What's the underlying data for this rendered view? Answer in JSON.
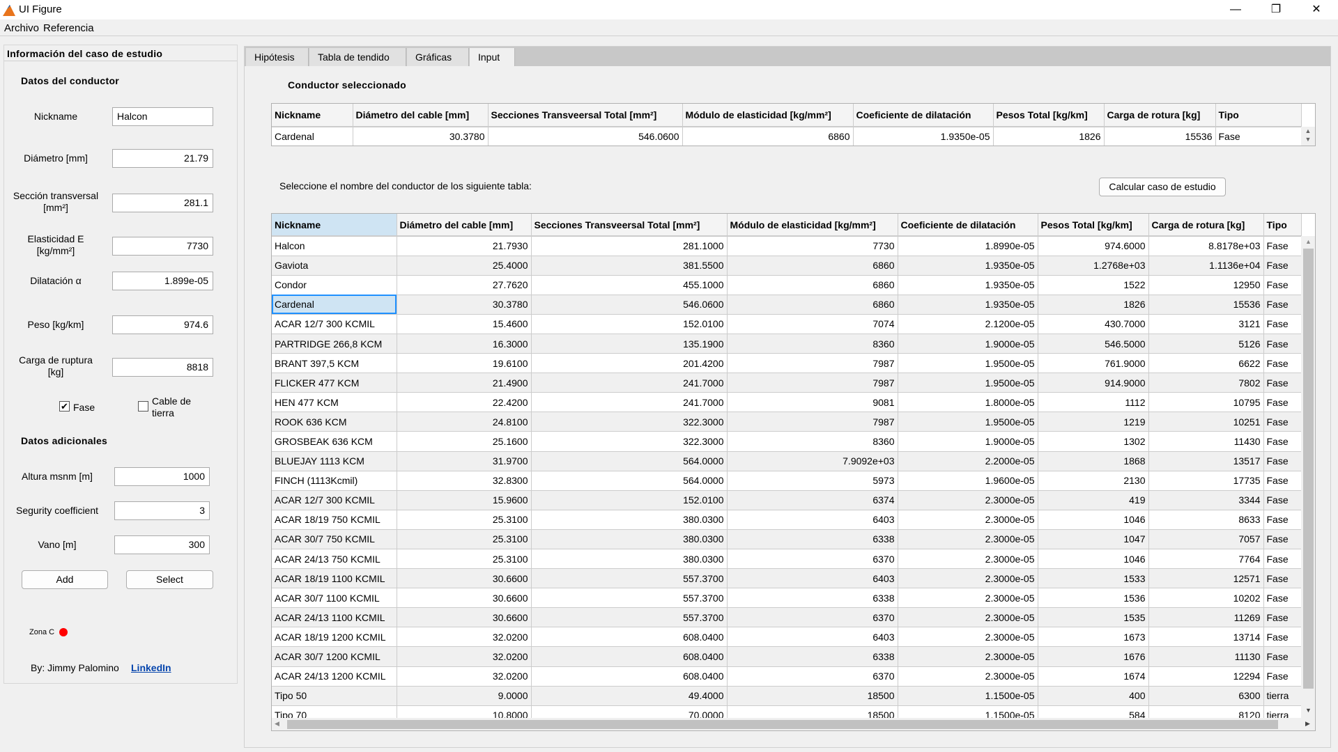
{
  "window": {
    "title": "UI Figure",
    "minimize": "—",
    "restore": "❐",
    "close": "✕"
  },
  "menu": [
    "Archivo",
    "Referencia"
  ],
  "left": {
    "title": "Información del caso de estudio",
    "conductor_heading": "Datos del conductor",
    "fields": [
      {
        "label": "Nickname",
        "value": "Halcon"
      },
      {
        "label": "Diámetro [mm]",
        "value": "21.79"
      },
      {
        "label": "Sección transversal [mm²]",
        "value": "281.1"
      },
      {
        "label": "Elasticidad E [kg/mm²]",
        "value": "7730"
      },
      {
        "label": "Dilatación α",
        "value": "1.899e-05"
      },
      {
        "label": "Peso [kg/km]",
        "value": "974.6"
      },
      {
        "label": "Carga de ruptura [kg]",
        "value": "8818"
      }
    ],
    "fase": {
      "label": "Fase",
      "checked": true
    },
    "tierra": {
      "label": "Cable de tierra",
      "checked": false
    },
    "additional_heading": "Datos adicionales",
    "extra": [
      {
        "label": "Altura msnm [m]",
        "value": "1000"
      },
      {
        "label": "Segurity coefficient",
        "value": "3"
      },
      {
        "label": "Vano [m]",
        "value": "300"
      }
    ],
    "add": "Add",
    "select": "Select",
    "zona": "Zona C",
    "zona_color": "#ff0000",
    "by": "By: Jimmy Palomino",
    "link": "LinkedIn"
  },
  "tabs": [
    {
      "label": "Hipótesis"
    },
    {
      "label": "Tabla de tendido"
    },
    {
      "label": "Gráficas"
    },
    {
      "label": "Input",
      "active": true
    }
  ],
  "selected": {
    "title": "Conductor seleccionado",
    "columns": [
      "Nickname",
      "Diámetro del cable [mm]",
      "Secciones Transveersal Total [mm²]",
      "Módulo de elasticidad [kg/mm²]",
      "Coeficiente de dilatación",
      "Pesos Total [kg/km]",
      "Carga de rotura [kg]",
      "Tipo"
    ],
    "row": [
      "Cardenal",
      "30.3780",
      "546.0600",
      "6860",
      "1.9350e-05",
      "1826",
      "15536",
      "Fase"
    ]
  },
  "instruction": "Seleccione el nombre del conductor de los siguiente tabla:",
  "calc_button": "Calcular caso de estudio",
  "table": {
    "columns": [
      "Nickname",
      "Diámetro del cable [mm]",
      "Secciones Transveersal Total [mm²]",
      "Módulo de elasticidad [kg/mm²]",
      "Coeficiente de dilatación",
      "Pesos Total [kg/km]",
      "Carga de rotura [kg]",
      "Tipo"
    ],
    "selected_row": 3,
    "rows": [
      [
        "Halcon",
        "21.7930",
        "281.1000",
        "7730",
        "1.8990e-05",
        "974.6000",
        "8.8178e+03",
        "Fase"
      ],
      [
        "Gaviota",
        "25.4000",
        "381.5500",
        "6860",
        "1.9350e-05",
        "1.2768e+03",
        "1.1136e+04",
        "Fase"
      ],
      [
        "Condor",
        "27.7620",
        "455.1000",
        "6860",
        "1.9350e-05",
        "1522",
        "12950",
        "Fase"
      ],
      [
        "Cardenal",
        "30.3780",
        "546.0600",
        "6860",
        "1.9350e-05",
        "1826",
        "15536",
        "Fase"
      ],
      [
        "ACAR 12/7 300 KCMIL",
        "15.4600",
        "152.0100",
        "7074",
        "2.1200e-05",
        "430.7000",
        "3121",
        "Fase"
      ],
      [
        "PARTRIDGE 266,8 KCM",
        "16.3000",
        "135.1900",
        "8360",
        "1.9000e-05",
        "546.5000",
        "5126",
        "Fase"
      ],
      [
        "BRANT 397,5 KCM",
        "19.6100",
        "201.4200",
        "7987",
        "1.9500e-05",
        "761.9000",
        "6622",
        "Fase"
      ],
      [
        "FLICKER 477 KCM",
        "21.4900",
        "241.7000",
        "7987",
        "1.9500e-05",
        "914.9000",
        "7802",
        "Fase"
      ],
      [
        "HEN 477 KCM",
        "22.4200",
        "241.7000",
        "9081",
        "1.8000e-05",
        "1112",
        "10795",
        "Fase"
      ],
      [
        "ROOK 636 KCM",
        "24.8100",
        "322.3000",
        "7987",
        "1.9500e-05",
        "1219",
        "10251",
        "Fase"
      ],
      [
        "GROSBEAK 636 KCM",
        "25.1600",
        "322.3000",
        "8360",
        "1.9000e-05",
        "1302",
        "11430",
        "Fase"
      ],
      [
        "BLUEJAY 1113 KCM",
        "31.9700",
        "564.0000",
        "7.9092e+03",
        "2.2000e-05",
        "1868",
        "13517",
        "Fase"
      ],
      [
        "FINCH (1113Kcmil)",
        "32.8300",
        "564.0000",
        "5973",
        "1.9600e-05",
        "2130",
        "17735",
        "Fase"
      ],
      [
        "ACAR 12/7 300 KCMIL",
        "15.9600",
        "152.0100",
        "6374",
        "2.3000e-05",
        "419",
        "3344",
        "Fase"
      ],
      [
        "ACAR 18/19 750 KCMIL",
        "25.3100",
        "380.0300",
        "6403",
        "2.3000e-05",
        "1046",
        "8633",
        "Fase"
      ],
      [
        "ACAR 30/7 750 KCMIL",
        "25.3100",
        "380.0300",
        "6338",
        "2.3000e-05",
        "1047",
        "7057",
        "Fase"
      ],
      [
        "ACAR 24/13 750 KCMIL",
        "25.3100",
        "380.0300",
        "6370",
        "2.3000e-05",
        "1046",
        "7764",
        "Fase"
      ],
      [
        "ACAR 18/19 1100 KCMIL",
        "30.6600",
        "557.3700",
        "6403",
        "2.3000e-05",
        "1533",
        "12571",
        "Fase"
      ],
      [
        "ACAR 30/7 1100 KCMIL",
        "30.6600",
        "557.3700",
        "6338",
        "2.3000e-05",
        "1536",
        "10202",
        "Fase"
      ],
      [
        "ACAR 24/13 1100 KCMIL",
        "30.6600",
        "557.3700",
        "6370",
        "2.3000e-05",
        "1535",
        "11269",
        "Fase"
      ],
      [
        "ACAR 18/19 1200 KCMIL",
        "32.0200",
        "608.0400",
        "6403",
        "2.3000e-05",
        "1673",
        "13714",
        "Fase"
      ],
      [
        "ACAR 30/7 1200 KCMIL",
        "32.0200",
        "608.0400",
        "6338",
        "2.3000e-05",
        "1676",
        "11130",
        "Fase"
      ],
      [
        "ACAR 24/13 1200 KCMIL",
        "32.0200",
        "608.0400",
        "6370",
        "2.3000e-05",
        "1674",
        "12294",
        "Fase"
      ],
      [
        "Tipo 50",
        "9.0000",
        "49.4000",
        "18500",
        "1.1500e-05",
        "400",
        "6300",
        "tierra"
      ],
      [
        "Tipo 70",
        "10.8000",
        "70.0000",
        "18500",
        "1.1500e-05",
        "584",
        "8120",
        "tierra"
      ]
    ]
  }
}
